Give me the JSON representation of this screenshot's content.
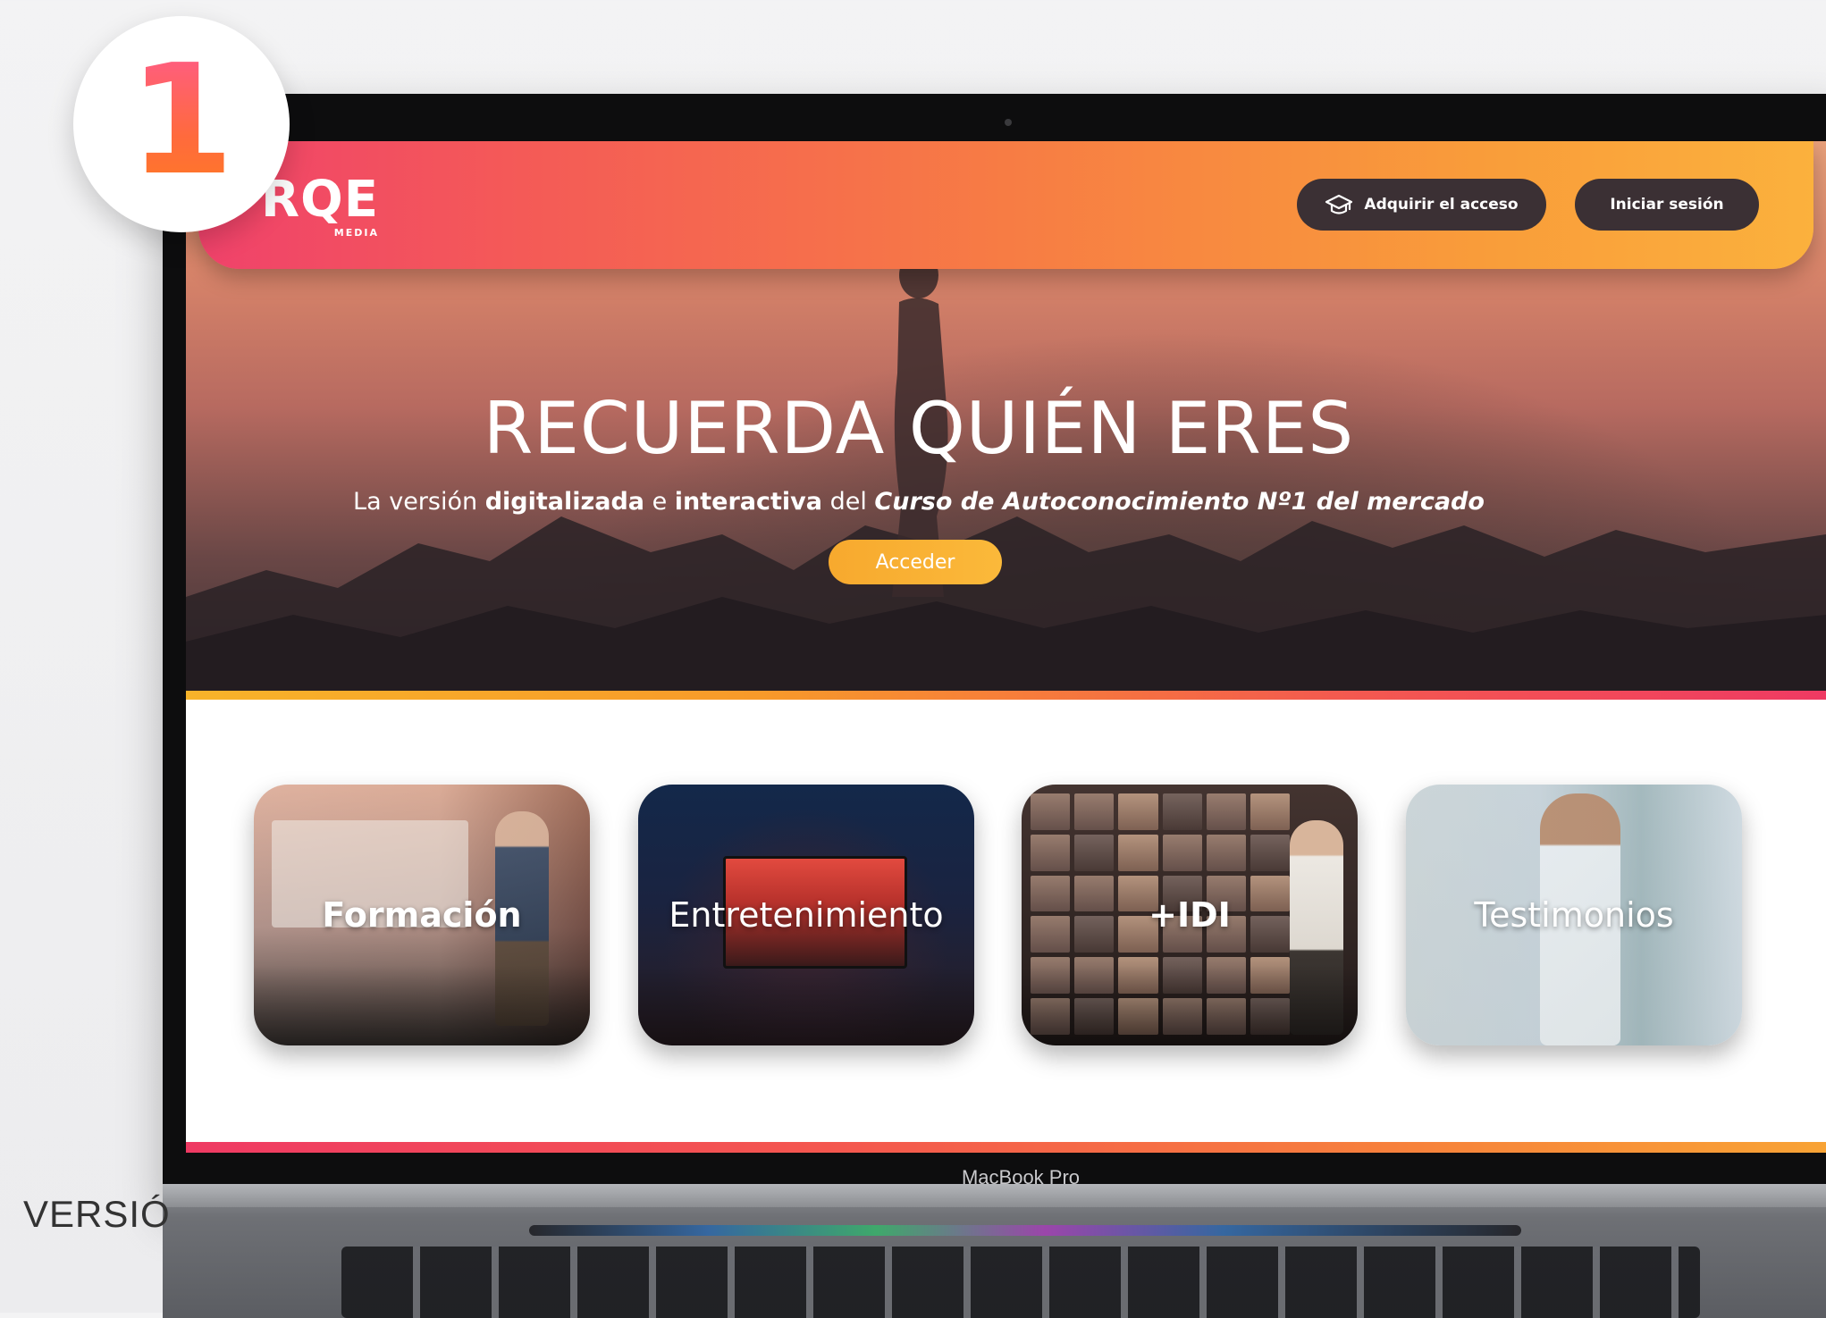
{
  "step_badge": {
    "number": "1"
  },
  "footer": {
    "version_text": "VERSIÓ"
  },
  "laptop": {
    "brand_label": "MacBook Pro"
  },
  "navbar": {
    "logo_text": "RQE",
    "logo_sub": "MEDIA",
    "acquire_button": "Adquirir el acceso",
    "login_button": "Iniciar sesión"
  },
  "hero": {
    "title": "RECUERDA QUIÉN ERES",
    "subtitle": {
      "part1": "La versión ",
      "part2": "digitalizada",
      "part3": " e ",
      "part4": "interactiva",
      "part5": " del ",
      "part6": "Curso de Autoconocimiento Nº1 del mercado"
    },
    "access_button": "Acceder"
  },
  "categories": [
    {
      "label": "Formación"
    },
    {
      "label": "Entretenimiento"
    },
    {
      "label": "+IDI"
    },
    {
      "label": "Testimonios"
    }
  ],
  "colors": {
    "nav_gradient_start": "#f0426b",
    "nav_gradient_end": "#fbb13d",
    "access_button": "#f7a92e",
    "dark_button": "#3b3034"
  }
}
